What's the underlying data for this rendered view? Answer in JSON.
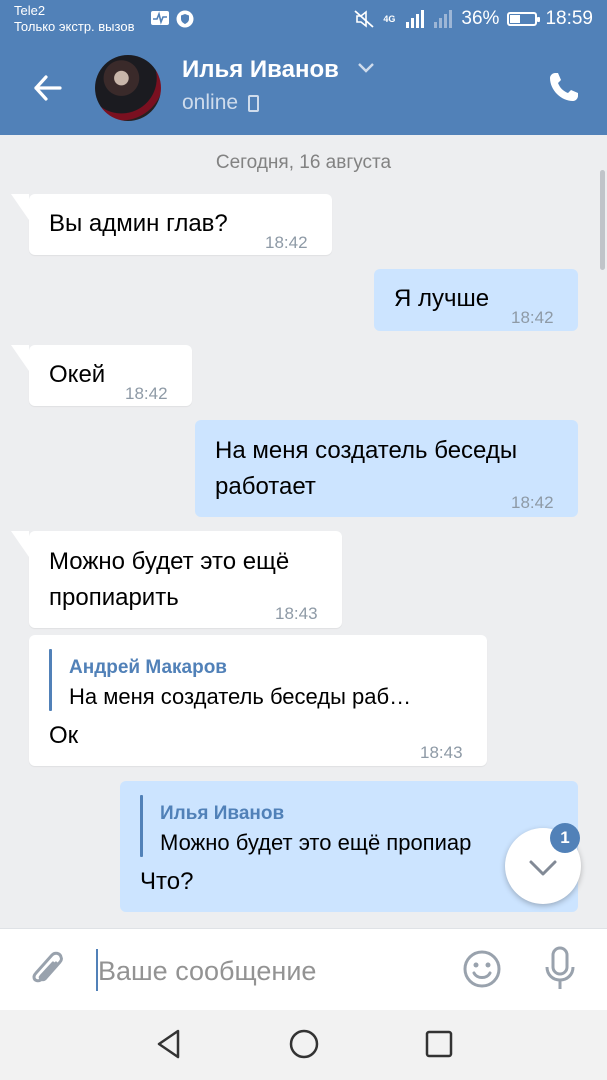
{
  "status_bar": {
    "carrier": "Tele2",
    "carrier_note": "Только экстр. вызов",
    "network": "4G",
    "battery_text": "36%",
    "battery_level": 0.36,
    "time": "18:59"
  },
  "header": {
    "contact_name": "Илья Иванов",
    "status": "online"
  },
  "chat": {
    "date_separator": "Сегодня, 16 августа",
    "messages": [
      {
        "direction": "in",
        "text": "Вы админ глав?",
        "time": "18:42"
      },
      {
        "direction": "out",
        "text": "Я лучше",
        "time": "18:42"
      },
      {
        "direction": "in",
        "text": "Окей",
        "time": "18:42"
      },
      {
        "direction": "out",
        "line1": "На меня создатель беседы",
        "line2": "работает",
        "time": "18:42"
      },
      {
        "direction": "in",
        "line1": "Можно будет это ещё",
        "line2": "пропиарить",
        "time": "18:43"
      },
      {
        "direction": "in",
        "reply_author": "Андрей Макаров",
        "reply_text": "На меня создатель беседы раб…",
        "text": "Ок",
        "time": "18:43"
      },
      {
        "direction": "out",
        "reply_author": "Илья Иванов",
        "reply_text": "Можно будет это ещё пропиар",
        "text": "Что?"
      }
    ],
    "unread_badge": "1"
  },
  "composer": {
    "placeholder": "Ваше сообщение"
  },
  "colors": {
    "accent": "#5181b8",
    "outgoing_bubble": "#cce4ff",
    "background": "#edeef0"
  }
}
